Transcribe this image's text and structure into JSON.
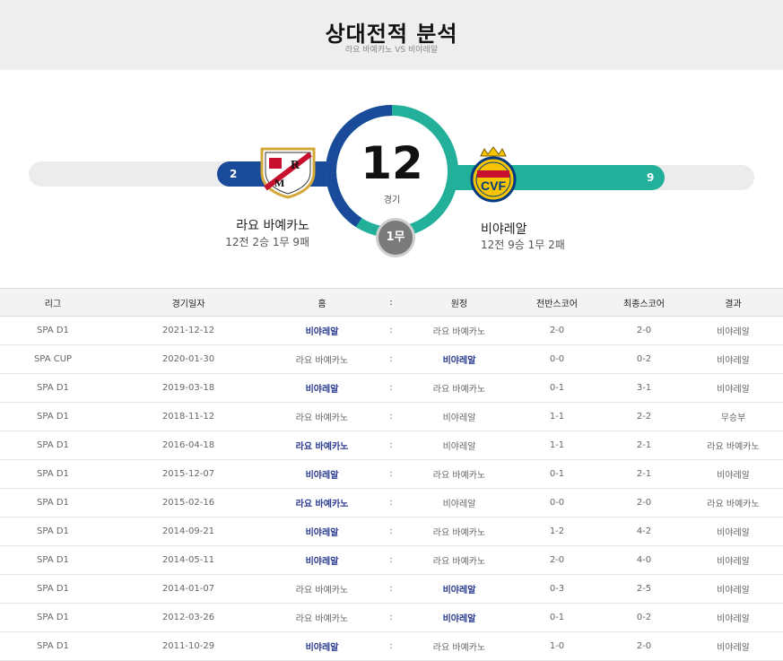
{
  "header": {
    "title": "상대전적 분석",
    "subtitle": "라요 바예카노 VS 비야레알"
  },
  "summary": {
    "total": "12",
    "total_label": "경기",
    "draws_label": "1무",
    "home": {
      "name": "라요 바예카노",
      "record": "12전 2승 1무 9패",
      "wins": "2",
      "color": "#1a4a9a"
    },
    "away": {
      "name": "비야레알",
      "record": "12전 9승 1무 2패",
      "wins": "9",
      "color": "#22b09a"
    }
  },
  "table": {
    "headers": [
      "리그",
      "경기일자",
      "홈",
      ":",
      "원정",
      "전반스코어",
      "최종스코어",
      "결과"
    ],
    "rows": [
      {
        "league": "SPA D1",
        "date": "2021-12-12",
        "home": "비야레알",
        "sep": ":",
        "away": "라요 바예카노",
        "half": "2-0",
        "final": "2-0",
        "result": "비야레알",
        "win": "home"
      },
      {
        "league": "SPA CUP",
        "date": "2020-01-30",
        "home": "라요 바예카노",
        "sep": ":",
        "away": "비야레알",
        "half": "0-0",
        "final": "0-2",
        "result": "비야레알",
        "win": "away"
      },
      {
        "league": "SPA D1",
        "date": "2019-03-18",
        "home": "비야레알",
        "sep": ":",
        "away": "라요 바예카노",
        "half": "0-1",
        "final": "3-1",
        "result": "비야레알",
        "win": "home"
      },
      {
        "league": "SPA D1",
        "date": "2018-11-12",
        "home": "라요 바예카노",
        "sep": ":",
        "away": "비야레알",
        "half": "1-1",
        "final": "2-2",
        "result": "무승부",
        "win": "none"
      },
      {
        "league": "SPA D1",
        "date": "2016-04-18",
        "home": "라요 바예카노",
        "sep": ":",
        "away": "비야레알",
        "half": "1-1",
        "final": "2-1",
        "result": "라요 바예카노",
        "win": "home"
      },
      {
        "league": "SPA D1",
        "date": "2015-12-07",
        "home": "비야레알",
        "sep": ":",
        "away": "라요 바예카노",
        "half": "0-1",
        "final": "2-1",
        "result": "비야레알",
        "win": "home"
      },
      {
        "league": "SPA D1",
        "date": "2015-02-16",
        "home": "라요 바예카노",
        "sep": ":",
        "away": "비야레알",
        "half": "0-0",
        "final": "2-0",
        "result": "라요 바예카노",
        "win": "home"
      },
      {
        "league": "SPA D1",
        "date": "2014-09-21",
        "home": "비야레알",
        "sep": ":",
        "away": "라요 바예카노",
        "half": "1-2",
        "final": "4-2",
        "result": "비야레알",
        "win": "home"
      },
      {
        "league": "SPA D1",
        "date": "2014-05-11",
        "home": "비야레알",
        "sep": ":",
        "away": "라요 바예카노",
        "half": "2-0",
        "final": "4-0",
        "result": "비야레알",
        "win": "home"
      },
      {
        "league": "SPA D1",
        "date": "2014-01-07",
        "home": "라요 바예카노",
        "sep": ":",
        "away": "비야레알",
        "half": "0-3",
        "final": "2-5",
        "result": "비야레알",
        "win": "away"
      },
      {
        "league": "SPA D1",
        "date": "2012-03-26",
        "home": "라요 바예카노",
        "sep": ":",
        "away": "비야레알",
        "half": "0-1",
        "final": "0-2",
        "result": "비야레알",
        "win": "away"
      },
      {
        "league": "SPA D1",
        "date": "2011-10-29",
        "home": "비야레알",
        "sep": ":",
        "away": "라요 바예카노",
        "half": "1-0",
        "final": "2-0",
        "result": "비야레알",
        "win": "home"
      }
    ]
  }
}
